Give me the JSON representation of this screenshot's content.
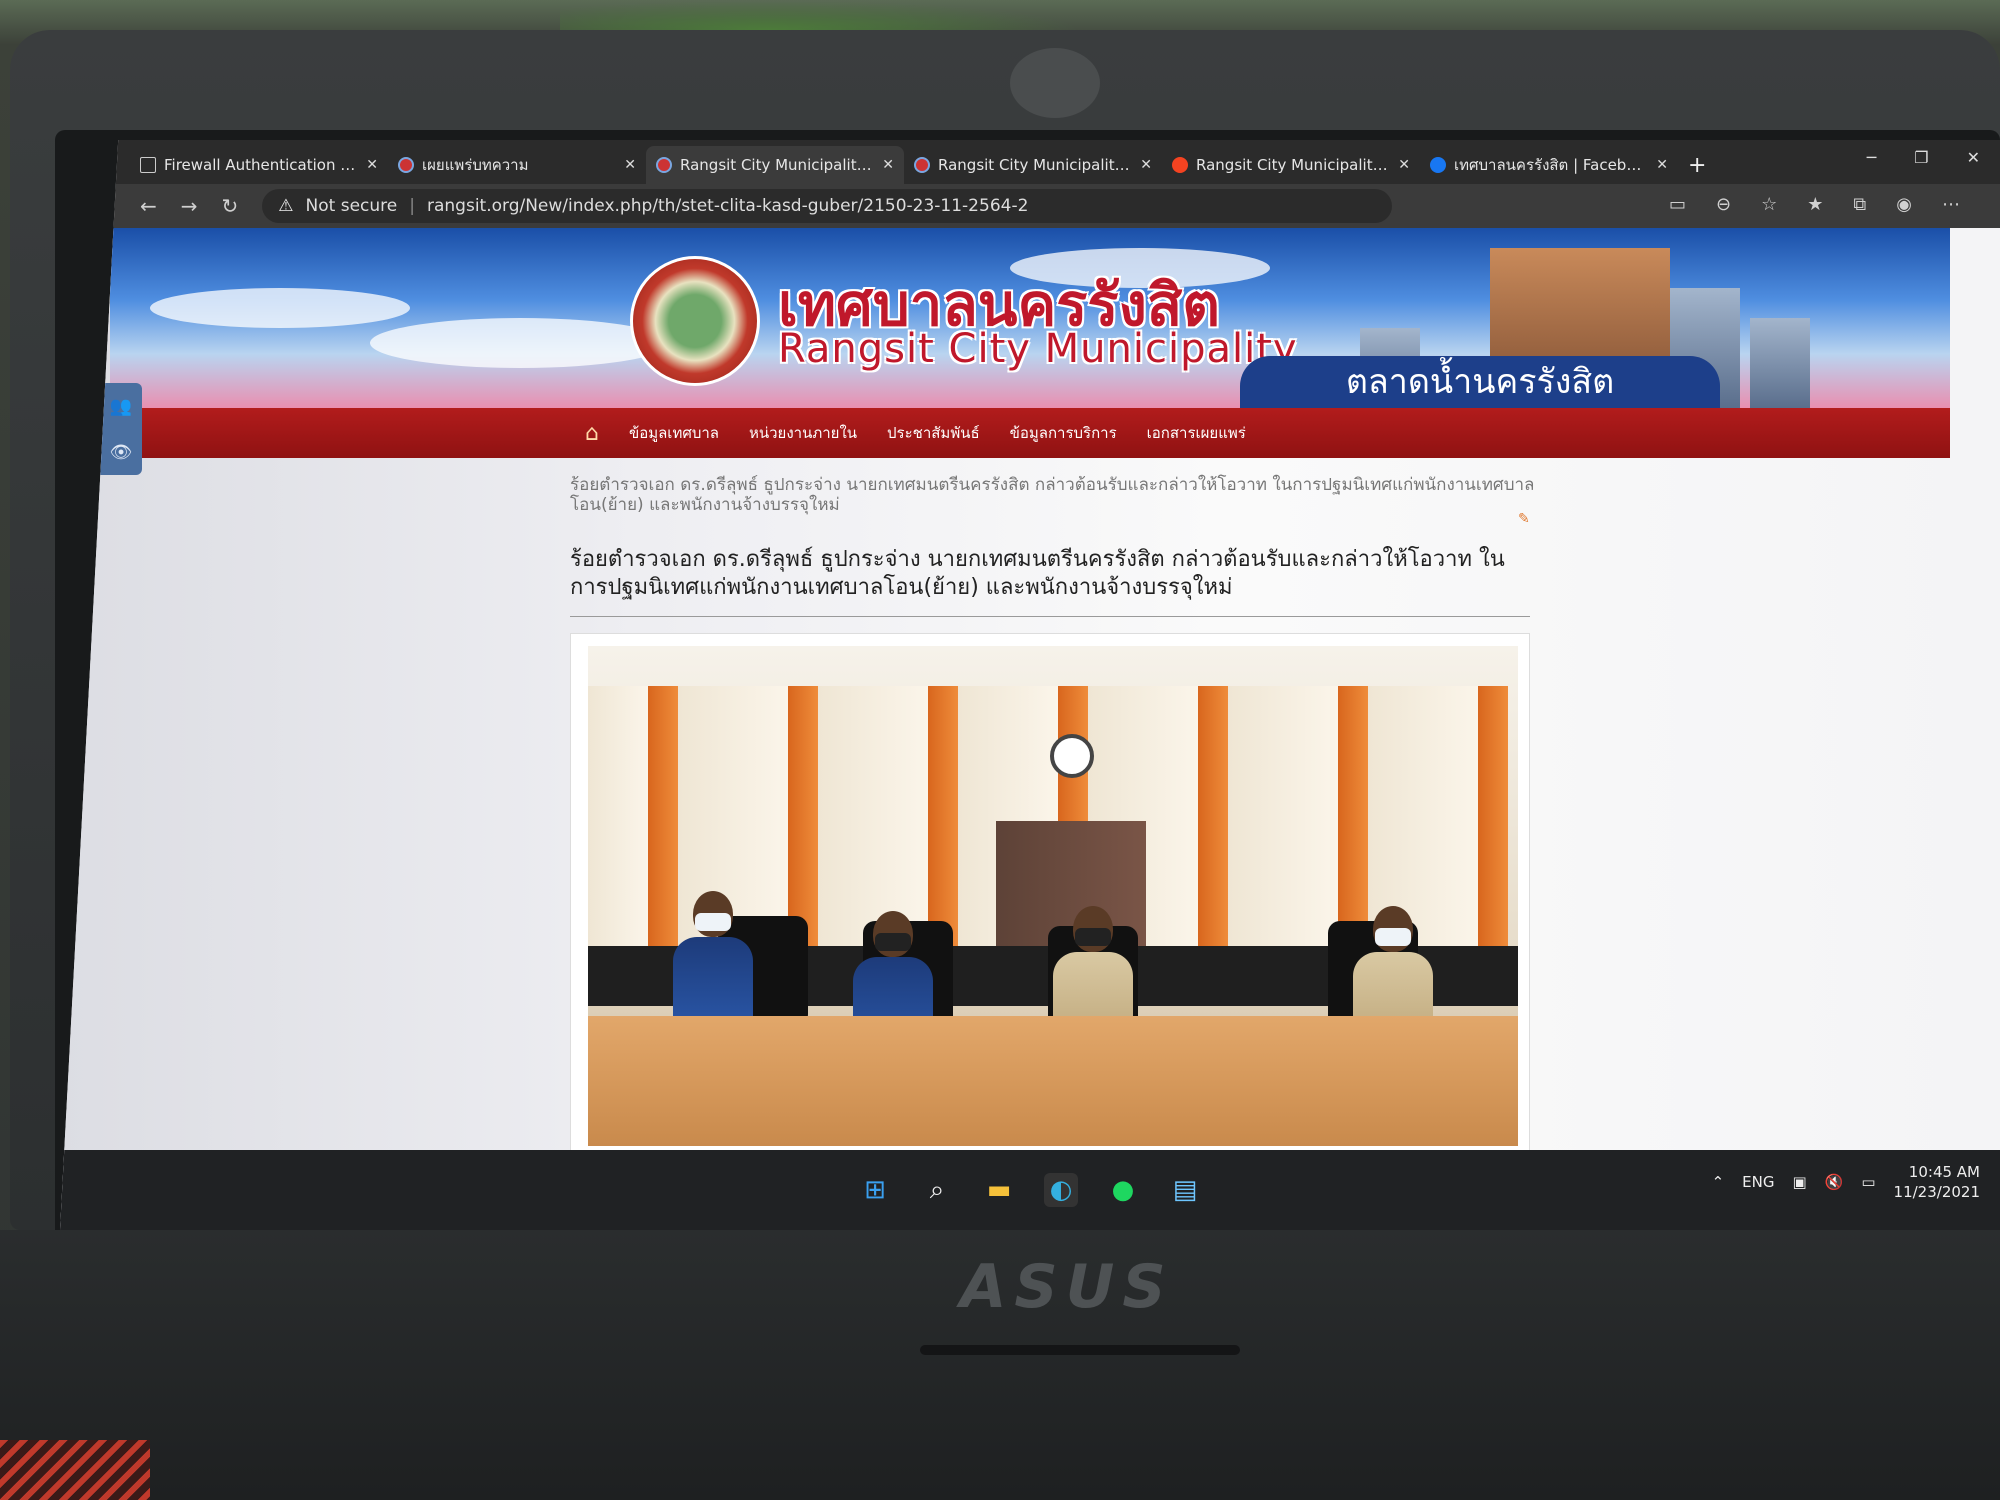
{
  "browser": {
    "tabs": [
      {
        "title": "Firewall Authentication Kee",
        "icon": "file-icon",
        "active": false
      },
      {
        "title": "เผยแพร่บทความ",
        "icon": "site-logo-icon",
        "active": false
      },
      {
        "title": "Rangsit City Municipality - ร",
        "icon": "site-logo-icon",
        "active": true
      },
      {
        "title": "Rangsit City Municipality - ร",
        "icon": "site-logo-icon",
        "active": false
      },
      {
        "title": "Rangsit City Municipality - A",
        "icon": "joomla-icon",
        "active": false
      },
      {
        "title": "เทศบาลนครรังสิต | Facebook",
        "icon": "facebook-icon",
        "active": false
      }
    ],
    "new_tab": "+",
    "security_label": "Not secure",
    "url": "rangsit.org/New/index.php/th/stet-clita-kasd-guber/2150-23-11-2564-2"
  },
  "site": {
    "title_th": "เทศบาลนครรังสิต",
    "title_en": "Rangsit City Municipality",
    "banner_text": "ตลาดน้ำนครรังสิต",
    "nav": [
      "ข้อมูลเทศบาล",
      "หน่วยงานภายใน",
      "ประชาสัมพันธ์",
      "ข้อมูลการบริการ",
      "เอกสารเผยแพร่"
    ],
    "breadcrumb": "ร้อยตำรวจเอก ดร.ดรีลุพธ์ ธูปกระจ่าง นายกเทศมนตรีนครรังสิต กล่าวต้อนรับและกล่าวให้โอวาท ในการปฐมนิเทศแก่พนักงานเทศบาลโอน(ย้าย) และพนักงานจ้างบรรจุใหม่",
    "headline": "ร้อยตำรวจเอก ดร.ดรีลุพธ์ ธูปกระจ่าง นายกเทศมนตรีนครรังสิต กล่าวต้อนรับและกล่าวให้โอวาท ในการปฐมนิเทศแก่พนักงานเทศบาลโอน(ย้าย) และพนักงานจ้างบรรจุใหม่"
  },
  "taskbar": {
    "language": "ENG",
    "time": "10:45 AM",
    "date": "11/23/2021"
  },
  "device": {
    "brand": "ASUS"
  },
  "colors": {
    "nav_red": "#a3161a",
    "title_red": "#c0182b",
    "taskbar": "#202224"
  }
}
